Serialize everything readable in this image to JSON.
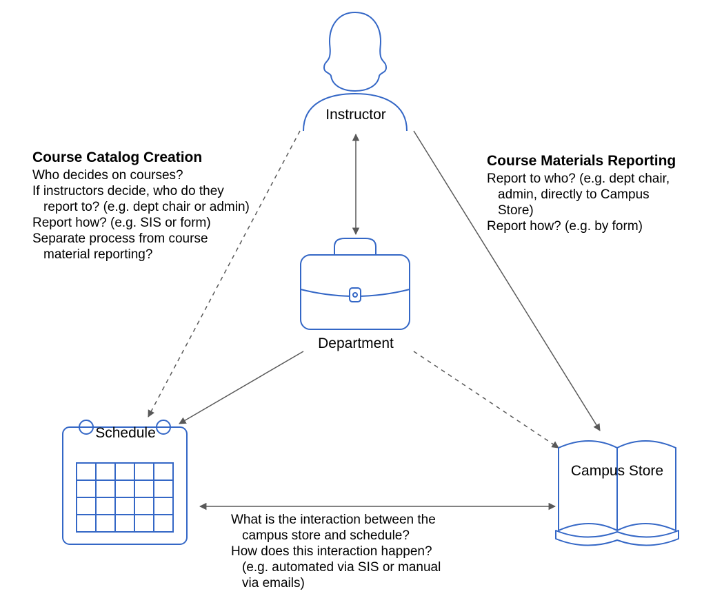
{
  "nodes": {
    "instructor": "Instructor",
    "department": "Department",
    "schedule": "Schedule",
    "store": "Campus Store"
  },
  "left": {
    "title": "Course Catalog Creation",
    "l1": "Who decides on courses?",
    "l2": "If instructors decide, who do they",
    "l3": "report to? (e.g. dept chair or admin)",
    "l4": "Report how? (e.g. SIS or form)",
    "l5": "Separate process from course",
    "l6": "material reporting?"
  },
  "right": {
    "title": "Course Materials Reporting",
    "l1": "Report to who? (e.g. dept chair,",
    "l2": "admin, directly to Campus",
    "l3": "Store)",
    "l4": "Report how? (e.g. by form)"
  },
  "bottom": {
    "l1": "What is the interaction between the",
    "l2": "campus store and schedule?",
    "l3": "How does this interaction happen?",
    "l4": "(e.g. automated via SIS or manual",
    "l5": "via emails)"
  }
}
